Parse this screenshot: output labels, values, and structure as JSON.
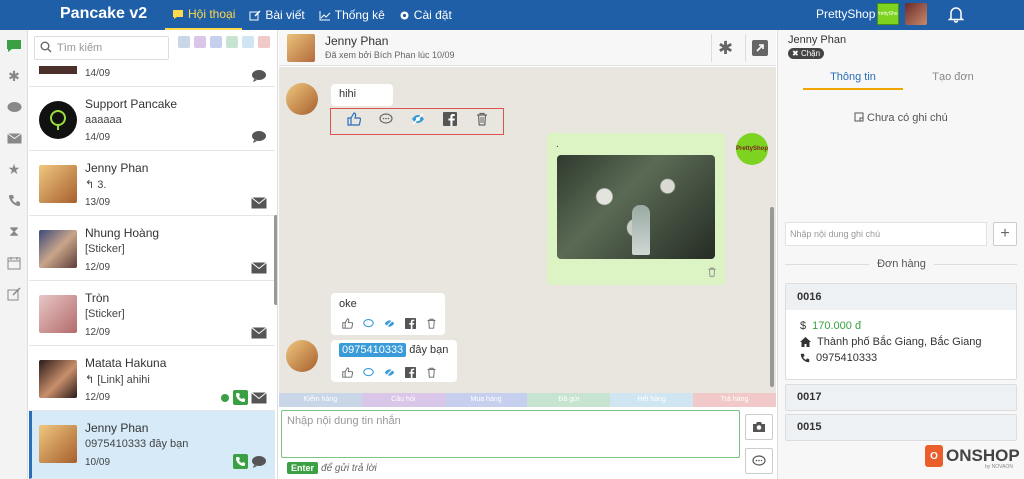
{
  "app": {
    "name": "Pancake v2"
  },
  "nav": [
    {
      "label": "Hội thoại",
      "icon": "chat-icon"
    },
    {
      "label": "Bài viết",
      "icon": "edit-icon"
    },
    {
      "label": "Thống kê",
      "icon": "chart-icon"
    },
    {
      "label": "Cài đặt",
      "icon": "gear-icon"
    }
  ],
  "header": {
    "shop_name": "PrettyShop",
    "shop_logo_text": "PrettyShop"
  },
  "search": {
    "placeholder": "Tìm kiếm"
  },
  "tag_colors": [
    "#c9d6e8",
    "#d9c6e8",
    "#c6d0ee",
    "#c6e4cf",
    "#cfe6f2",
    "#f2c9c9"
  ],
  "conversations": [
    {
      "name": "",
      "preview": "",
      "date": "14/09",
      "icon": "chat-bubble-icon"
    },
    {
      "name": "Support Pancake",
      "preview": "aaaaaa",
      "date": "14/09",
      "icon": "chat-bubble-icon"
    },
    {
      "name": "Jenny Phan",
      "preview": "3.",
      "date": "13/09",
      "icon": "mail-icon",
      "replied": true
    },
    {
      "name": "Nhung Hoàng",
      "preview": "[Sticker]",
      "date": "12/09",
      "icon": "mail-icon"
    },
    {
      "name": "Tròn",
      "preview": "[Sticker]",
      "date": "12/09",
      "icon": "mail-icon"
    },
    {
      "name": "Matata Hakuna",
      "preview": "[Link] ahihi",
      "date": "12/09",
      "icon": "mail-icon",
      "replied": true
    },
    {
      "name": "Jenny Phan",
      "preview": "0975410333 đây bạn",
      "date": "10/09",
      "icon": "chat-bubble-icon",
      "selected": true
    }
  ],
  "chat": {
    "name": "Jenny Phan",
    "seen_status": "Đã xem bởi Bích Phan lúc 10/09",
    "messages": [
      {
        "from": "customer",
        "text": "hihi"
      },
      {
        "from": "page",
        "text": ".",
        "attachment": "photo",
        "avatar_text": "PrettyShop"
      },
      {
        "from": "customer",
        "text": "oke"
      },
      {
        "from": "customer",
        "phone": "0975410333",
        "text": "đây bạn"
      }
    ],
    "composer_placeholder": "Nhập nội dung tin nhắn",
    "enter_key": "Enter",
    "enter_hint": "để gửi trả lời"
  },
  "quick_tags": [
    {
      "label": "Kiểm hàng",
      "color": "#c9d6e8"
    },
    {
      "label": "Câu hỏi",
      "color": "#d9c6e8"
    },
    {
      "label": "Mua hàng",
      "color": "#c6d0ee"
    },
    {
      "label": "Đã gửi",
      "color": "#c6e4cf"
    },
    {
      "label": "Hết hàng",
      "color": "#cfe6f2"
    },
    {
      "label": "Trả hàng",
      "color": "#f2c9c9"
    }
  ],
  "right_panel": {
    "customer_name": "Jenny Phan",
    "block_label": "Chặn",
    "tabs": [
      "Thông tin",
      "Tạo đơn"
    ],
    "no_note": "Chưa có ghi chú",
    "note_placeholder": "Nhập nội dung ghi chú",
    "orders_title": "Đơn hàng",
    "orders": [
      {
        "id": "0016",
        "price": "170.000 đ",
        "address": "Thành phố Bắc Giang, Bắc Giang",
        "phone": "0975410333"
      },
      {
        "id": "0017"
      },
      {
        "id": "0015"
      }
    ]
  },
  "brand_footer": {
    "logo_letter": "O",
    "name": "ONSHOP",
    "sub": "by NOVAON"
  }
}
